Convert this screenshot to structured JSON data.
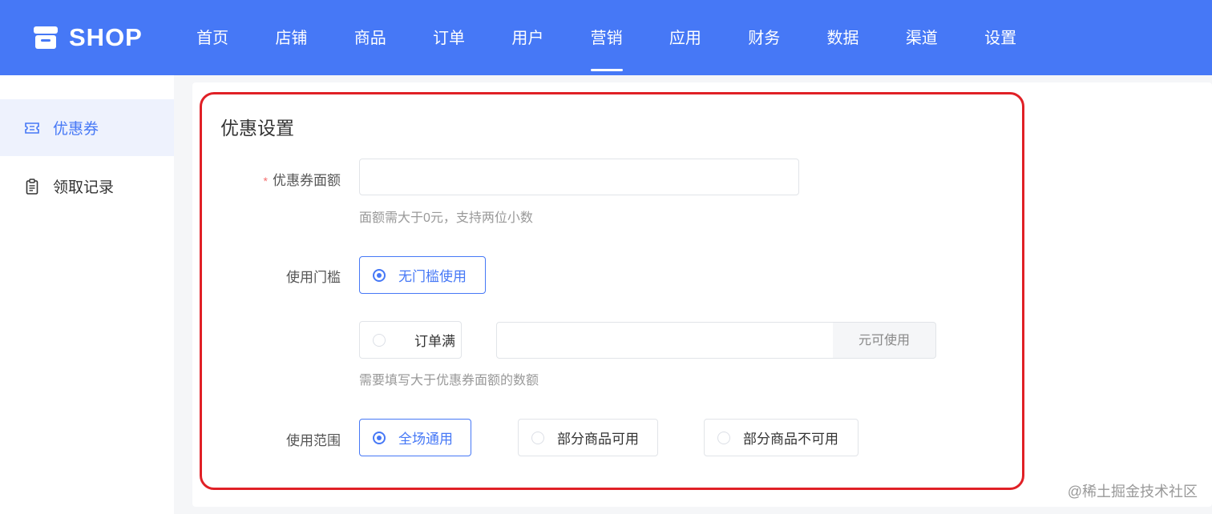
{
  "header": {
    "logo_text": "SHOP",
    "nav": [
      {
        "label": "首页"
      },
      {
        "label": "店铺"
      },
      {
        "label": "商品"
      },
      {
        "label": "订单"
      },
      {
        "label": "用户"
      },
      {
        "label": "营销",
        "active": true
      },
      {
        "label": "应用"
      },
      {
        "label": "财务"
      },
      {
        "label": "数据"
      },
      {
        "label": "渠道"
      },
      {
        "label": "设置"
      }
    ],
    "bg_color": "#4678f6"
  },
  "sidebar": {
    "items": [
      {
        "label": "优惠券",
        "icon": "ticket-icon",
        "active": true
      },
      {
        "label": "领取记录",
        "icon": "clipboard-icon",
        "active": false
      }
    ]
  },
  "form": {
    "title": "优惠设置",
    "amount": {
      "required_mark": "*",
      "label": "优惠券面额",
      "value": "",
      "hint": "面额需大于0元，支持两位小数"
    },
    "threshold": {
      "label": "使用门槛",
      "option_none": "无门槛使用",
      "option_order": "订单满",
      "order_value": "",
      "order_suffix": "元可使用",
      "hint": "需要填写大于优惠券面额的数额",
      "selected": "none"
    },
    "scope": {
      "label": "使用范围",
      "options": [
        "全场通用",
        "部分商品可用",
        "部分商品不可用"
      ],
      "selected": "全场通用"
    }
  },
  "watermark": "@稀土掘金技术社区",
  "colors": {
    "primary": "#4678f6",
    "highlight_border": "#e02026",
    "required": "#f56c6c"
  }
}
